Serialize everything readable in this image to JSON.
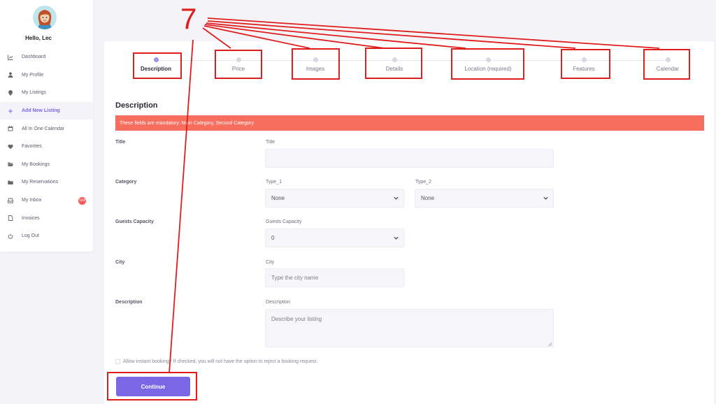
{
  "sidebar": {
    "greeting": "Hello, Lec",
    "items": [
      {
        "label": "Dashboard",
        "icon": "chart-icon"
      },
      {
        "label": "My Profile",
        "icon": "user-icon"
      },
      {
        "label": "My Listings",
        "icon": "pin-icon"
      },
      {
        "label": "Add New Listing",
        "icon": "plus-icon",
        "active": true
      },
      {
        "label": "All In One Calendar",
        "icon": "calendar-icon"
      },
      {
        "label": "Favorites",
        "icon": "heart-icon"
      },
      {
        "label": "My Bookings",
        "icon": "folder-open-icon"
      },
      {
        "label": "My Reservations",
        "icon": "folder-icon"
      },
      {
        "label": "My Inbox",
        "icon": "inbox-icon",
        "badge": "164"
      },
      {
        "label": "Invoices",
        "icon": "file-icon"
      },
      {
        "label": "Log Out",
        "icon": "power-icon"
      }
    ]
  },
  "steps": [
    {
      "label": "Description",
      "active": true
    },
    {
      "label": "Price"
    },
    {
      "label": "Images"
    },
    {
      "label": "Details"
    },
    {
      "label": "Location (required)"
    },
    {
      "label": "Features"
    },
    {
      "label": "Calendar"
    }
  ],
  "form": {
    "section_title": "Description",
    "alert": "These fields are mandatory: Main Category, Second Category",
    "title": {
      "row_label": "Title",
      "field_label": "Title",
      "value": ""
    },
    "category": {
      "row_label": "Category",
      "type1_label": "Type_1",
      "type1_value": "None",
      "type2_label": "Type_2",
      "type2_value": "None"
    },
    "guests": {
      "row_label": "Guests Capacity",
      "field_label": "Guests Capacity",
      "value": "0"
    },
    "city": {
      "row_label": "City",
      "field_label": "City",
      "placeholder": "Type the city name"
    },
    "description": {
      "row_label": "Description",
      "field_label": "Description",
      "placeholder": "Describe your listing"
    },
    "instant_booking": "Allow instant booking? If checked, you will not have the option to reject a booking request.",
    "continue_label": "Continue"
  },
  "annotation": {
    "number": "7",
    "color": "#e01d1d"
  },
  "colors": {
    "accent": "#7b67e6",
    "alert": "#f76e5e",
    "badge": "#f35a5a"
  }
}
